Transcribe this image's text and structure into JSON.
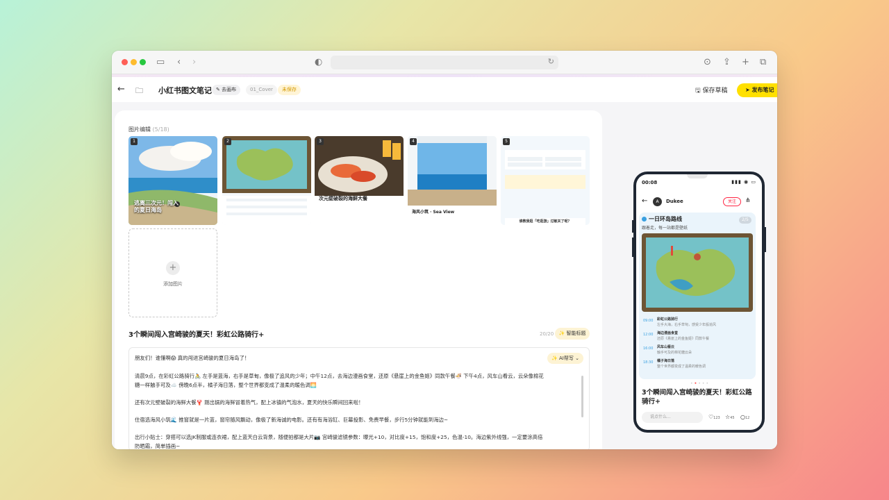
{
  "header": {
    "title": "小红书图文笔记",
    "canvas_label": "去画布",
    "cover_tag": "01_Cover",
    "unsaved_tag": "未保存",
    "save_draft_label": "保存草稿",
    "publish_label": "发布笔记"
  },
  "images": {
    "section_label": "图片编辑",
    "count": "(5/18)",
    "add_label": "添加图片",
    "thumbs": [
      {
        "num": "1",
        "caption": "逃离三次元！闯入的夏日海岛"
      },
      {
        "num": "2",
        "caption": ""
      },
      {
        "num": "3",
        "caption": "次元壁破裂的海鲜大餐"
      },
      {
        "num": "4",
        "caption": "海风小筑 · Sea View"
      },
      {
        "num": "5",
        "caption": "谁教我逛「吃逛游」过敏关了呢？"
      }
    ]
  },
  "headline": {
    "text": "3个瞬间闯入宫崎骏的夏天！彩虹公路骑行+",
    "count": "20/20",
    "smart_label": "智能标题"
  },
  "body": {
    "ai_label": "AI帮写",
    "paragraphs": [
      "朋友们！谁懂啊😱 真的闯进宫崎骏的夏日海岛了！",
      "清晨9点，在彩虹公路骑行🚴 左手是蓝海，右手是草甸，像极了追风的少年；中午12点，去海边漫画食堂，还原《悬崖上的金鱼姬》同款午餐🍜 下午4点，风车山看云，云朵像棉花糖一样触手可及☁️ 傍晚6点半，橘子海日落，整个世界都变成了温柔的暖色调🌅",
      "还有次元壁破裂的海鲜大餐🦞 刚出锅的海鲜冒着热气，配上冰镇的气泡水，夏天的快乐瞬间回来啦！",
      "住宿选海风小筑🌊 推窗就是一片蓝，窗帘随风飘动，像极了新海诚的电影。还有有海浴缸、巨幕投影、免费早餐，步行5分钟就能到海边~",
      "出行小贴士：穿搭可以选JK制服或连衣裙，配上蓝天白云背景，随便拍都是大片📷 宫崎骏滤镜参数：曝光+10，对比度+15，饱和度+25，色温-10。海边紫外线强，一定要涂高倍防晒霜，简单插画~"
    ]
  },
  "phone": {
    "time": "00:08",
    "status": "▮▮▮ ◉ ▭",
    "author": "Dukee",
    "follow_label": "关注",
    "card_title": "一日环岛路线",
    "card_sub": "跟着走，每一站都是壁纸",
    "page": "2/5",
    "schedule": [
      {
        "time": "09:00",
        "name": "彩虹公路骑行",
        "desc": "左手大海，右手草甸，感受少年般追风"
      },
      {
        "time": "12:00",
        "name": "海边漫画食堂",
        "desc": "还原《悬崖上的金鱼姬》同款午餐"
      },
      {
        "time": "16:00",
        "name": "风车山看云",
        "desc": "触手可及的棉花糖云朵"
      },
      {
        "time": "18:30",
        "name": "橘子海日落",
        "desc": "整个世界都变成了温柔的暖色调"
      }
    ],
    "title": "3个瞬间闯入宫崎骏的夏天！彩虹公路骑行+",
    "comment_placeholder": "说点什么...",
    "likes": "123",
    "stars": "45",
    "comments": "12"
  }
}
